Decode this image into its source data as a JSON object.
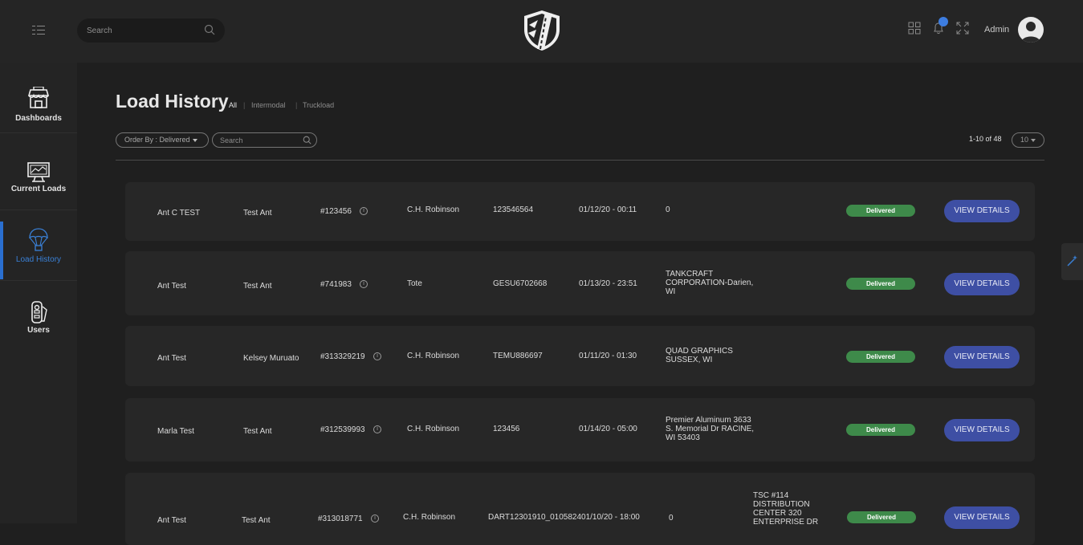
{
  "header": {
    "search_placeholder": "Search",
    "notification_count": "",
    "user_label": "Admin"
  },
  "sidebar": {
    "items": [
      {
        "label": "Dashboards"
      },
      {
        "label": "Current Loads"
      },
      {
        "label": "Load History"
      },
      {
        "label": "Users"
      }
    ],
    "active": "Load History"
  },
  "page": {
    "title": "Load History",
    "filters": [
      "All",
      "Intermodal",
      "Truckload"
    ],
    "active_filter": "All",
    "order_by_label": "Order By : Delivered",
    "search_placeholder": "Search",
    "pagination_text": "1-10 of 48",
    "per_page": "10"
  },
  "rows": [
    {
      "name": "Ant C TEST",
      "contact": "Test Ant",
      "load_no": "#123456",
      "carrier": "C.H. Robinson",
      "ref": "123546564",
      "date": "01/12/20 - 00:11",
      "dest": [
        "0"
      ],
      "status": "Delivered",
      "action": "VIEW DETAILS"
    },
    {
      "name": "Ant Test",
      "contact": "Test Ant",
      "load_no": "#741983",
      "carrier": "Tote",
      "ref": "GESU6702668",
      "date": "01/13/20 - 23:51",
      "dest": [
        "TANKCRAFT",
        "CORPORATION-Darien,",
        "WI"
      ],
      "status": "Delivered",
      "action": "VIEW DETAILS"
    },
    {
      "name": "Ant Test",
      "contact": "Kelsey Muruato",
      "load_no": "#313329219",
      "carrier": "C.H. Robinson",
      "ref": "TEMU886697",
      "date": "01/11/20 - 01:30",
      "dest": [
        "QUAD GRAPHICS",
        "SUSSEX, WI"
      ],
      "status": "Delivered",
      "action": "VIEW DETAILS"
    },
    {
      "name": "Marla Test",
      "contact": "Test Ant",
      "load_no": "#312539993",
      "carrier": "C.H. Robinson",
      "ref": "123456",
      "date": "01/14/20 - 05:00",
      "dest": [
        "Premier Aluminum 3633",
        "S. Memorial Dr RACINE,",
        "WI 53403"
      ],
      "status": "Delivered",
      "action": "VIEW DETAILS"
    },
    {
      "name": "Ant Test",
      "contact": "Test Ant",
      "load_no": "#313018771",
      "carrier": "C.H. Robinson",
      "ref": "DART12301910_010582401/10/20 - 18:00",
      "date": "0",
      "dest": [
        "TSC #114",
        "DISTRIBUTION",
        "CENTER 320",
        "ENTERPRISE DR"
      ],
      "status": "Delivered",
      "action": "VIEW DETAILS"
    }
  ],
  "colors": {
    "background": "#1f1f1f",
    "card": "#272727",
    "accent_blue": "#3e4fa4",
    "status_green": "#3e8a4a",
    "active_sidebar": "#2a6fd0"
  },
  "icons": [
    "menu-icon",
    "search-icon",
    "shield-road-logo",
    "grid-icon",
    "bell-icon",
    "fullscreen-icon",
    "avatar-icon",
    "dashboard-store-icon",
    "monitor-chart-icon",
    "parachute-icon",
    "users-icon",
    "info-icon",
    "magic-wand-icon"
  ]
}
